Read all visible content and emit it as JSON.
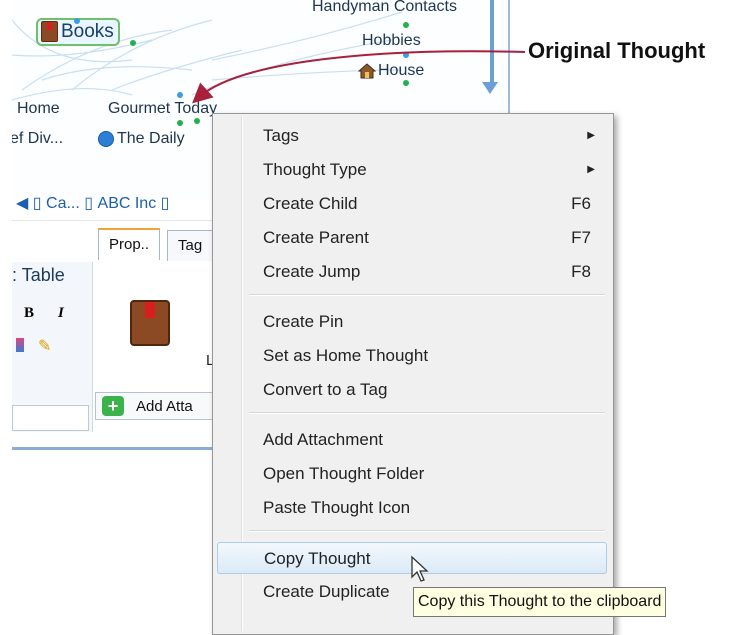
{
  "map": {
    "nodes": {
      "handyman": "Handyman Contacts",
      "books": "Books",
      "hobbies": "Hobbies",
      "house": "House",
      "home": "Home",
      "gourmet": "Gourmet Today",
      "chef_div": "ef Div...",
      "daily": "The Daily"
    },
    "breadcrumb": [
      "Ca...",
      "ABC Inc"
    ]
  },
  "panel": {
    "tabs": [
      "Prop..",
      "Tag"
    ],
    "table_label": "Table",
    "bold_label": "B",
    "italic_label": "I",
    "add_attachment": "Add Atta",
    "l_label": "L"
  },
  "annotation": {
    "label": "Original Thought"
  },
  "context_menu": {
    "items": [
      {
        "label": "Tags",
        "shortcut": "",
        "submenu": true
      },
      {
        "label": "Thought Type",
        "shortcut": "",
        "submenu": true
      },
      {
        "label": "Create Child",
        "shortcut": "F6",
        "submenu": false
      },
      {
        "label": "Create Parent",
        "shortcut": "F7",
        "submenu": false
      },
      {
        "label": "Create Jump",
        "shortcut": "F8",
        "submenu": false
      },
      {
        "label": "Create Pin",
        "shortcut": "",
        "submenu": false
      },
      {
        "label": "Set as Home Thought",
        "shortcut": "",
        "submenu": false
      },
      {
        "label": "Convert to a Tag",
        "shortcut": "",
        "submenu": false
      },
      {
        "label": "Add Attachment",
        "shortcut": "",
        "submenu": false
      },
      {
        "label": "Open Thought Folder",
        "shortcut": "",
        "submenu": false
      },
      {
        "label": "Paste Thought Icon",
        "shortcut": "",
        "submenu": false
      },
      {
        "label": "Copy Thought",
        "shortcut": "",
        "submenu": false,
        "highlighted": true
      },
      {
        "label": "Create Duplicate",
        "shortcut": "",
        "submenu": false
      }
    ]
  },
  "tooltip": {
    "text": "Copy this Thought to the clipboard"
  },
  "colors": {
    "annotation_arrow": "#a8203a",
    "menu_bg": "#f0f0f0",
    "highlight": "#dbeaf7",
    "tooltip_bg": "#ffffe1"
  }
}
